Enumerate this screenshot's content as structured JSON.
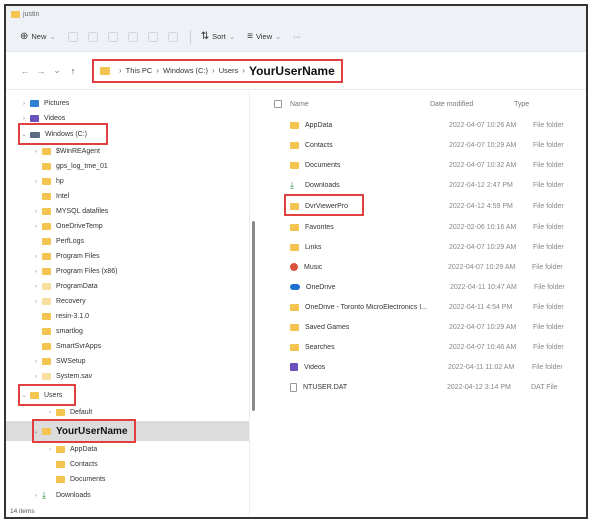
{
  "titlebar": {
    "title": "justin"
  },
  "toolbar": {
    "new_label": "New",
    "sort_label": "Sort",
    "view_label": "View",
    "more_label": "···"
  },
  "address": {
    "this_pc": "This PC",
    "drive": "Windows (C:)",
    "users": "Users",
    "user": "YourUserName"
  },
  "columns": {
    "name": "Name",
    "date": "Date modified",
    "type": "Type"
  },
  "nav": [
    {
      "label": "Pictures",
      "icon": "pictures-icon",
      "exp": "›"
    },
    {
      "label": "Videos",
      "icon": "videos-icon",
      "exp": "›"
    },
    {
      "label": "Windows (C:)",
      "icon": "drive-icon",
      "exp": "⌄"
    },
    {
      "label": "$WinREAgent",
      "icon": "folder-icon",
      "exp": "›"
    },
    {
      "label": "gps_log_tme_01",
      "icon": "folder-icon",
      "exp": ""
    },
    {
      "label": "hp",
      "icon": "folder-icon",
      "exp": "›"
    },
    {
      "label": "Intel",
      "icon": "folder-icon",
      "exp": ""
    },
    {
      "label": "MYSQL datafiles",
      "icon": "folder-icon",
      "exp": "›"
    },
    {
      "label": "OneDriveTemp",
      "icon": "folder-icon",
      "exp": "›"
    },
    {
      "label": "PerfLogs",
      "icon": "folder-icon",
      "exp": ""
    },
    {
      "label": "Program Files",
      "icon": "folder-icon",
      "exp": "›"
    },
    {
      "label": "Program Files (x86)",
      "icon": "folder-icon",
      "exp": "›"
    },
    {
      "label": "ProgramData",
      "icon": "folder-icon",
      "exp": "›"
    },
    {
      "label": "Recovery",
      "icon": "folder-icon",
      "exp": "›"
    },
    {
      "label": "resin-3.1.0",
      "icon": "folder-icon",
      "exp": ""
    },
    {
      "label": "smartlog",
      "icon": "folder-icon",
      "exp": ""
    },
    {
      "label": "SmartSvrApps",
      "icon": "folder-icon",
      "exp": ""
    },
    {
      "label": "SWSetup",
      "icon": "folder-icon",
      "exp": "›"
    },
    {
      "label": "System.sav",
      "icon": "folder-icon",
      "exp": "›"
    },
    {
      "label": "Users",
      "icon": "folder-icon",
      "exp": "⌄"
    },
    {
      "label": "Default",
      "icon": "folder-icon",
      "exp": "›"
    },
    {
      "label": "YourUserName",
      "icon": "folder-icon",
      "exp": "⌄"
    },
    {
      "label": "AppData",
      "icon": "folder-icon",
      "exp": "›"
    },
    {
      "label": "Contacts",
      "icon": "folder-icon",
      "exp": ""
    },
    {
      "label": "Documents",
      "icon": "folder-icon",
      "exp": ""
    },
    {
      "label": "Downloads",
      "icon": "downloads-icon",
      "exp": "›"
    }
  ],
  "status": {
    "count": "14 items"
  },
  "files": [
    {
      "name": "AppData",
      "date": "2022-04-07 10:26 AM",
      "type": "File folder",
      "icon": "folder-icon"
    },
    {
      "name": "Contacts",
      "date": "2022-04-07 10:29 AM",
      "type": "File folder",
      "icon": "folder-icon"
    },
    {
      "name": "Documents",
      "date": "2022-04-07 10:32 AM",
      "type": "File folder",
      "icon": "folder-icon"
    },
    {
      "name": "Downloads",
      "date": "2022-04-12 2:47 PM",
      "type": "File folder",
      "icon": "downloads-icon"
    },
    {
      "name": "DvrViewerPro",
      "date": "2022-04-12 4:59 PM",
      "type": "File folder",
      "icon": "folder-icon"
    },
    {
      "name": "Favorites",
      "date": "2022-02-06 10:16 AM",
      "type": "File folder",
      "icon": "folder-icon"
    },
    {
      "name": "Links",
      "date": "2022-04-07 10:29 AM",
      "type": "File folder",
      "icon": "folder-icon"
    },
    {
      "name": "Music",
      "date": "2022-04-07 10:29 AM",
      "type": "File folder",
      "icon": "music-icon"
    },
    {
      "name": "OneDrive",
      "date": "2022-04-11 10:47 AM",
      "type": "File folder",
      "icon": "onedrive-icon"
    },
    {
      "name": "OneDrive - Toronto MicroElectronics I...",
      "date": "2022-04-11 4:54 PM",
      "type": "File folder",
      "icon": "folder-icon"
    },
    {
      "name": "Saved Games",
      "date": "2022-04-07 10:29 AM",
      "type": "File folder",
      "icon": "folder-icon"
    },
    {
      "name": "Searches",
      "date": "2022-04-07 10:46 AM",
      "type": "File folder",
      "icon": "folder-icon"
    },
    {
      "name": "Videos",
      "date": "2022-04-11 11:02 AM",
      "type": "File folder",
      "icon": "videos-icon"
    },
    {
      "name": "NTUSER.DAT",
      "date": "2022-04-12 3:14 PM",
      "type": "DAT File",
      "icon": "file-icon"
    }
  ]
}
